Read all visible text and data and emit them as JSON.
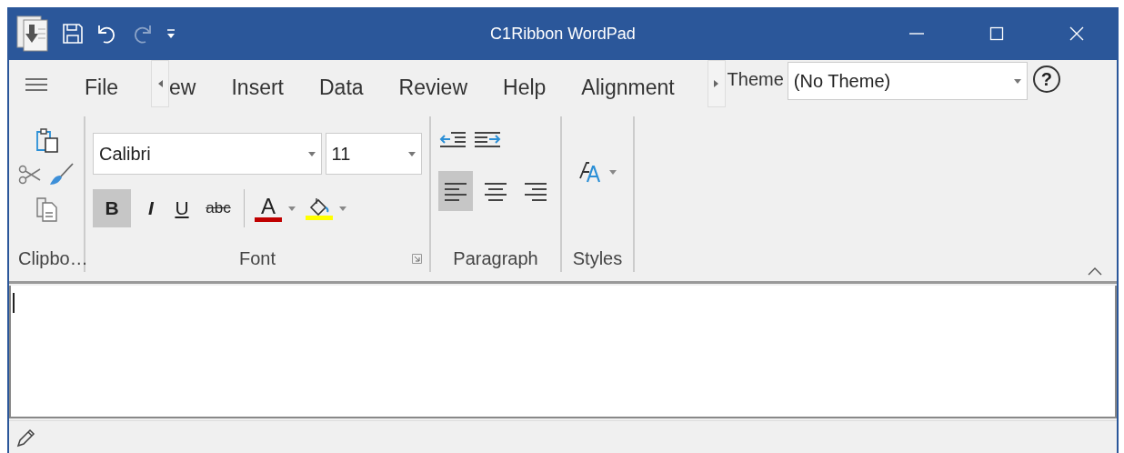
{
  "window": {
    "title": "C1Ribbon WordPad",
    "redo_disabled": true
  },
  "tabs": [
    {
      "label": "File",
      "selected": false
    },
    {
      "label": "ew",
      "selected": false
    },
    {
      "label": "Insert",
      "selected": false
    },
    {
      "label": "Data",
      "selected": false
    },
    {
      "label": "Review",
      "selected": false
    },
    {
      "label": "Help",
      "selected": false
    },
    {
      "label": "Alignment",
      "selected": false
    }
  ],
  "theme": {
    "label": "Theme",
    "value": "(No Theme)",
    "help": "?"
  },
  "groups": [
    {
      "kind": "clipboard",
      "label": "Clipbo…"
    },
    {
      "kind": "font",
      "label": "Font",
      "font": "Calibri",
      "size": "11",
      "toggles": [
        {
          "label": "B",
          "kind": "bold",
          "selected": true
        },
        {
          "label": "I",
          "kind": "italic",
          "selected": false
        },
        {
          "label": "U",
          "kind": "underline",
          "selected": false
        },
        {
          "label": "abc",
          "kind": "strike",
          "selected": false
        }
      ],
      "colors": [
        {
          "kind": "text",
          "label": "A",
          "color": "#c00000"
        },
        {
          "kind": "highlight",
          "color": "#ffff00"
        }
      ]
    },
    {
      "kind": "paragraph",
      "label": "Paragraph",
      "aligns": [
        {
          "kind": "left",
          "selected": true
        },
        {
          "kind": "center",
          "selected": false
        },
        {
          "kind": "right",
          "selected": false
        }
      ]
    },
    {
      "kind": "styles",
      "label": "Styles"
    }
  ]
}
